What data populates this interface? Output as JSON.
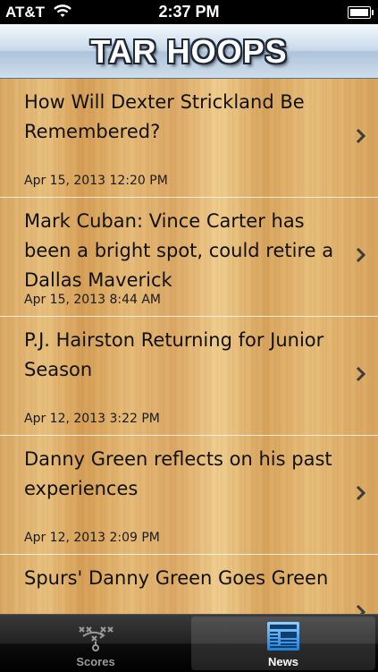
{
  "status_bar": {
    "carrier": "AT&T",
    "time": "2:37 PM"
  },
  "nav": {
    "title": "TAR HOOPS"
  },
  "news": [
    {
      "title": "How Will Dexter Strickland Be Remembered?",
      "date": "Apr 15, 2013 12:20 PM"
    },
    {
      "title": "Mark Cuban: Vince Carter has been a bright spot, could retire a Dallas Maverick",
      "date": "Apr 15, 2013 8:44 AM"
    },
    {
      "title": "P.J. Hairston Returning for Junior Season",
      "date": "Apr 12, 2013 3:22 PM"
    },
    {
      "title": "Danny Green reflects on his past experiences",
      "date": "Apr 12, 2013 2:09 PM"
    },
    {
      "title": "Spurs' Danny Green Goes Green",
      "date": ""
    }
  ],
  "tabs": [
    {
      "label": "Scores",
      "icon": "playbook-icon",
      "selected": false
    },
    {
      "label": "News",
      "icon": "newspaper-icon",
      "selected": true
    }
  ],
  "colors": {
    "nav_title_outline": "#1e2a3a",
    "wood_base": "#e0b06c",
    "tab_selected_text": "#ffffff",
    "tab_unselected_text": "#9a9a9a"
  }
}
